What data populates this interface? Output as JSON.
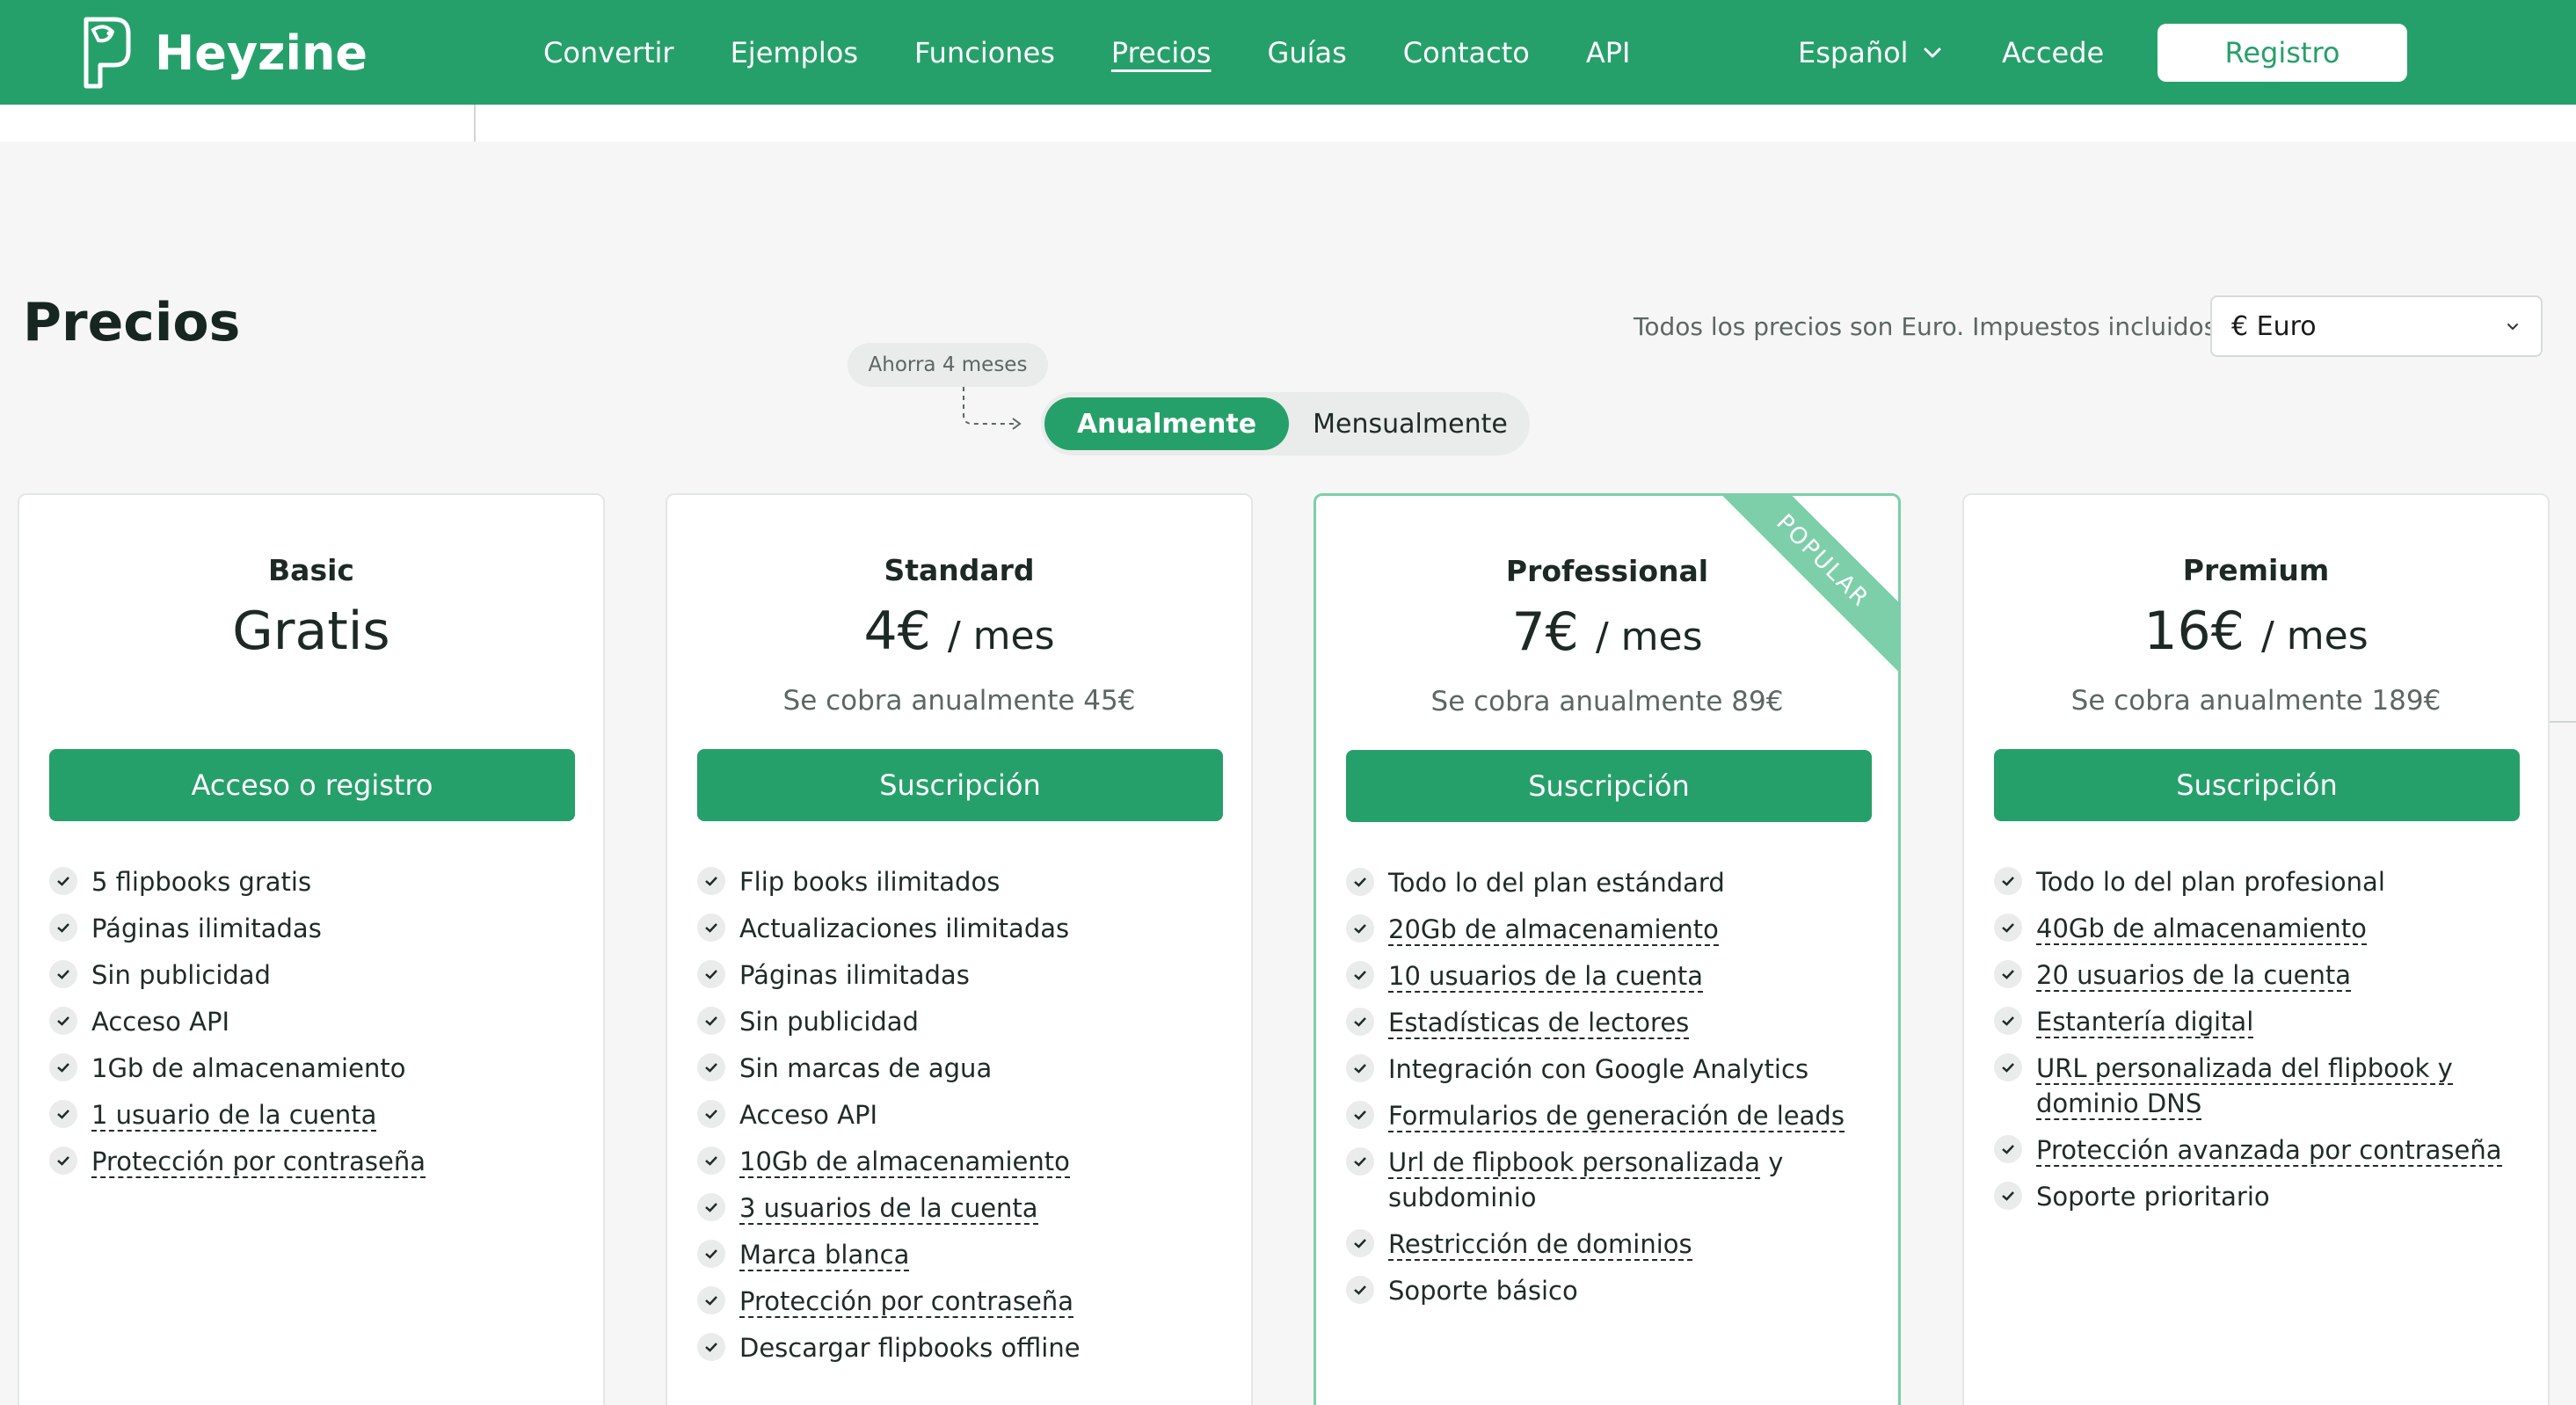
{
  "header": {
    "logo_text": "Heyzine",
    "nav": [
      {
        "label": "Convertir"
      },
      {
        "label": "Ejemplos"
      },
      {
        "label": "Funciones"
      },
      {
        "label": "Precios"
      },
      {
        "label": "Guías"
      },
      {
        "label": "Contacto"
      },
      {
        "label": "API"
      }
    ],
    "language": "Español",
    "login": "Accede",
    "register": "Registro"
  },
  "pricing": {
    "title": "Precios",
    "note": "Todos los precios son Euro. Impuestos incluidos.",
    "currency": "€ Euro",
    "savings_badge": "Ahorra 4 meses",
    "toggle_annual": "Anualmente",
    "toggle_monthly": "Mensualmente",
    "popular_ribbon": "POPULAR"
  },
  "plans": [
    {
      "name": "Basic",
      "price": "Gratis",
      "unit": "",
      "billing": "",
      "button": "Acceso o registro",
      "features": [
        "5 flipbooks gratis",
        "Páginas ilimitadas",
        "Sin publicidad",
        "Acceso API",
        "1Gb de almacenamiento",
        "1 usuario de la cuenta",
        "Protección por contraseña"
      ]
    },
    {
      "name": "Standard",
      "price": "4€",
      "unit": "/ mes",
      "billing": "Se cobra anualmente 45€",
      "button": "Suscripción",
      "features": [
        "Flip books ilimitados",
        "Actualizaciones ilimitadas",
        "Páginas ilimitadas",
        "Sin publicidad",
        "Sin marcas de agua",
        "Acceso API",
        "10Gb de almacenamiento",
        "3 usuarios de la cuenta",
        "Marca blanca",
        "Protección por contraseña",
        "Descargar flipbooks offline"
      ]
    },
    {
      "name": "Professional",
      "price": "7€",
      "unit": "/ mes",
      "billing": "Se cobra anualmente 89€",
      "button": "Suscripción",
      "features": [
        "Todo lo del plan estándard",
        "20Gb de almacenamiento",
        "10 usuarios de la cuenta",
        "Estadísticas de lectores",
        "Integración con Google Analytics",
        "Formularios de generación de leads",
        "Url de flipbook personalizada",
        "y subdominio",
        "Restricción de dominios",
        "Soporte básico"
      ]
    },
    {
      "name": "Premium",
      "price": "16€",
      "unit": "/ mes",
      "billing": "Se cobra anualmente 189€",
      "button": "Suscripción",
      "features": [
        "Todo lo del plan profesional",
        "40Gb de almacenamiento",
        "20 usuarios de la cuenta",
        "Estantería digital",
        "URL personalizada del flipbook y dominio DNS",
        "Protección avanzada por contraseña",
        "Soporte prioritario"
      ]
    }
  ],
  "colors": {
    "brand": "#26a06a",
    "popular": "#7dcfa9"
  }
}
